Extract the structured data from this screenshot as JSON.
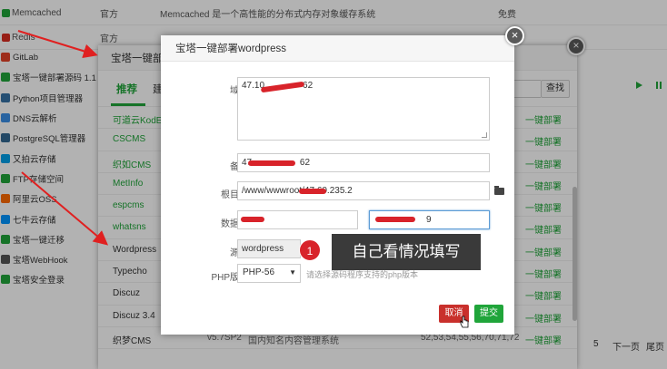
{
  "background_rows": [
    {
      "name": "Memcached",
      "type": "官方",
      "desc": "Memcached 是一个高性能的分布式内存对象缓存系统",
      "price": "免费"
    },
    {
      "name": "Redis",
      "type": "官方",
      "desc": "",
      "price": ""
    }
  ],
  "left_nav": [
    {
      "label": "GitLab",
      "color": "#e24329"
    },
    {
      "label": "宝塔一键部署源码 1.1",
      "color": "#20a53a"
    },
    {
      "label": "Python项目管理器",
      "color": "#3572a5"
    },
    {
      "label": "DNS云解析",
      "color": "#3a8ee6"
    },
    {
      "label": "PostgreSQL管理器",
      "color": "#336791"
    },
    {
      "label": "又拍云存储",
      "color": "#00a0e9"
    },
    {
      "label": "FTP存储空间",
      "color": "#20a53a"
    },
    {
      "label": "阿里云OSS",
      "color": "#ff6a00"
    },
    {
      "label": "七牛云存储",
      "color": "#0096ff"
    },
    {
      "label": "宝塔一键迁移",
      "color": "#20a53a"
    },
    {
      "label": "宝塔WebHook",
      "color": "#555555"
    },
    {
      "label": "宝塔安全登录",
      "color": "#20a53a"
    }
  ],
  "mid_dialog": {
    "title": "宝塔一键部署",
    "tab_active": "推荐",
    "tab_second": "建",
    "search_label": "查找",
    "apps": [
      {
        "name": "可道云KodExp",
        "action": "一键部署",
        "ver": "",
        "desc": "",
        "php": "",
        "green": true
      },
      {
        "name": "CSCMS",
        "action": "一键部署",
        "ver": "",
        "desc": "",
        "php": "",
        "green": true
      },
      {
        "name": "织如CMS",
        "action": "一键部署",
        "ver": "",
        "desc": "",
        "php": "",
        "green": true
      },
      {
        "name": "MetInfo",
        "action": "一键部署",
        "ver": "",
        "desc": "",
        "php": "",
        "green": true
      },
      {
        "name": "espcms",
        "action": "一键部署",
        "ver": "",
        "desc": "",
        "php": "",
        "green": true
      },
      {
        "name": "whatsns",
        "action": "一键部署",
        "ver": "",
        "desc": "",
        "php": "",
        "green": true
      },
      {
        "name": "Wordpress",
        "action": "一键部署",
        "ver": "",
        "desc": "",
        "php": "",
        "green": false
      },
      {
        "name": "Typecho",
        "action": "一键部署",
        "ver": "",
        "desc": "",
        "php": "",
        "green": false
      },
      {
        "name": "Discuz",
        "action": "一键部署",
        "ver": "",
        "desc": "",
        "php": "",
        "green": false
      },
      {
        "name": "Discuz 3.4",
        "action": "一键部署",
        "ver": "",
        "desc": "",
        "php": "",
        "green": false
      },
      {
        "name": "织梦CMS",
        "action": "一键部署",
        "ver": "v5.7SP2",
        "desc": "国内知名内容管理系统",
        "php": "52,53,54,55,56,70,71,72",
        "green": false
      }
    ]
  },
  "right_fragments": {
    "page_count": "5",
    "next_page": "下一页",
    "last_page": "尾页"
  },
  "dialog": {
    "title": "宝塔一键部署wordpress",
    "domain_label": "域名",
    "domain_value": "47.10",
    "domain_value_tail": "62",
    "remark_label": "备注",
    "remark_value": "47.",
    "remark_value_tail": "62",
    "root_label": "根目录",
    "root_value": "/www/wwwroot/47.",
    "root_value_tail": "60.235.2",
    "db_label": "数据库",
    "db_value2_tail": "9",
    "source_label": "源码",
    "source_value": "wordpress",
    "php_label": "PHP版本",
    "php_value": "PHP-56",
    "php_hint": "请选择源码程序支持的php版本",
    "cancel_label": "取消",
    "submit_label": "提交"
  },
  "annotation": {
    "number": "1",
    "text": "自己看情况填写"
  }
}
